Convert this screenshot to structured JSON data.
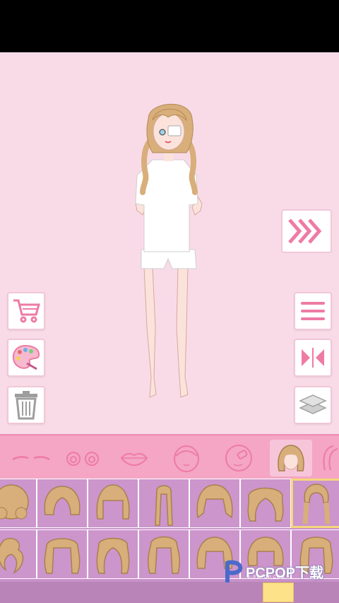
{
  "colors": {
    "background": "#f9dbe8",
    "accent": "#ee7ba4",
    "category_bar": "#f4a6c4",
    "grid": "#c891c9",
    "hair": "#d8ae7a"
  },
  "side_buttons_left": [
    {
      "icon": "shopping-cart-icon"
    },
    {
      "icon": "palette-icon"
    },
    {
      "icon": "trash-icon"
    }
  ],
  "side_buttons_right": [
    {
      "icon": "menu-icon"
    },
    {
      "icon": "mirror-flip-icon"
    },
    {
      "icon": "layers-icon"
    }
  ],
  "next_button": {
    "icon": "triple-chevron-right-icon"
  },
  "categories": [
    {
      "icon": "eyebrows-icon"
    },
    {
      "icon": "eyes-icon"
    },
    {
      "icon": "lips-icon"
    },
    {
      "icon": "face-icon"
    },
    {
      "icon": "face-sticker-icon"
    },
    {
      "icon": "hair-icon",
      "selected": true
    },
    {
      "icon": "hair-side-icon"
    }
  ],
  "hair_grid": {
    "selected_index": 6,
    "rows": 2,
    "columns": 7
  },
  "watermark": {
    "text": "PCPOP下载",
    "sub": "G-PCPOP.COM"
  }
}
